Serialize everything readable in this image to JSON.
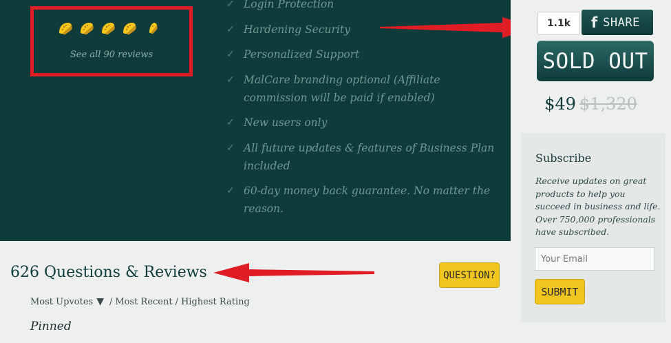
{
  "rating": {
    "tacos_full": 4,
    "tacos_total": 5,
    "reviews_link": "See all 90 reviews"
  },
  "features": [
    "Login Protection",
    "Hardening Security",
    "Personalized Support",
    "MalCare branding optional (Affiliate commission will be paid if enabled)",
    "New users only",
    "All future updates & features of Business Plan included",
    "60-day money back guarantee. No matter the reason."
  ],
  "share": {
    "count": "1.1k",
    "icon": "facebook-icon",
    "label": "SHARE"
  },
  "purchase": {
    "status_label": "SOLD OUT",
    "price": "$49",
    "original_price": "$1,320"
  },
  "subscribe": {
    "title": "Subscribe",
    "text": "Receive updates on great products to help you succeed in business and life. Over 750,000 professionals have subscribed.",
    "email_placeholder": "Your Email",
    "submit_label": "SUBMIT"
  },
  "questions": {
    "title": "626 Questions & Reviews",
    "ask_label": "QUESTION?",
    "sort": {
      "options": [
        "Most Upvotes",
        "Most Recent",
        "Highest Rating"
      ],
      "active_arrow": "▼",
      "separator": "/"
    },
    "pinned_label": "Pinned"
  },
  "colors": {
    "hero_bg": "#0f3b3b",
    "accent_yellow": "#f0c51d",
    "annotation_red": "#e01c24",
    "feature_text": "#6d9994"
  }
}
